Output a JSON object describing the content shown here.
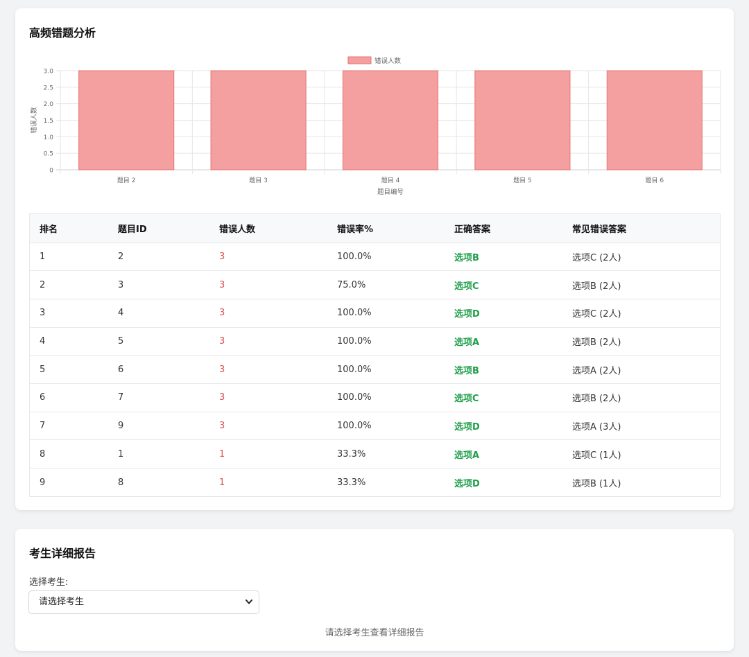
{
  "analysis": {
    "title": "高频错题分析"
  },
  "chart_data": {
    "type": "bar",
    "categories": [
      "题目 2",
      "题目 3",
      "题目 4",
      "题目 5",
      "题目 6"
    ],
    "series": [
      {
        "name": "错误人数",
        "values": [
          3,
          3,
          3,
          3,
          3
        ]
      }
    ],
    "xlabel": "题目编号",
    "ylabel": "错误人数",
    "ylim": [
      0,
      3
    ],
    "yticks": [
      "0",
      "0.5",
      "1.0",
      "1.5",
      "2.0",
      "2.5",
      "3.0"
    ],
    "grid": true,
    "legend": "top-center",
    "bar_color": "#f4a0a0",
    "bar_border": "#e57373"
  },
  "table": {
    "headers": [
      "排名",
      "题目ID",
      "错误人数",
      "错误率%",
      "正确答案",
      "常见错误答案"
    ],
    "rows": [
      [
        "1",
        "2",
        "3",
        "100.0%",
        "选项B",
        "选项C (2人)"
      ],
      [
        "2",
        "3",
        "3",
        "75.0%",
        "选项C",
        "选项B (2人)"
      ],
      [
        "3",
        "4",
        "3",
        "100.0%",
        "选项D",
        "选项C (2人)"
      ],
      [
        "4",
        "5",
        "3",
        "100.0%",
        "选项A",
        "选项B (2人)"
      ],
      [
        "5",
        "6",
        "3",
        "100.0%",
        "选项B",
        "选项A (2人)"
      ],
      [
        "6",
        "7",
        "3",
        "100.0%",
        "选项C",
        "选项B (2人)"
      ],
      [
        "7",
        "9",
        "3",
        "100.0%",
        "选项D",
        "选项A (3人)"
      ],
      [
        "8",
        "1",
        "1",
        "33.3%",
        "选项A",
        "选项C (1人)"
      ],
      [
        "9",
        "8",
        "1",
        "33.3%",
        "选项D",
        "选项B (1人)"
      ]
    ]
  },
  "report": {
    "title": "考生详细报告",
    "select_label": "选择考生:",
    "select_value": "请选择考生",
    "hint": "请选择考生查看详细报告"
  },
  "colors": {
    "wrong": "#d9534f",
    "correct": "#1e9e4a"
  },
  "icons": {
    "select_chevron": "chevron-down-icon"
  }
}
